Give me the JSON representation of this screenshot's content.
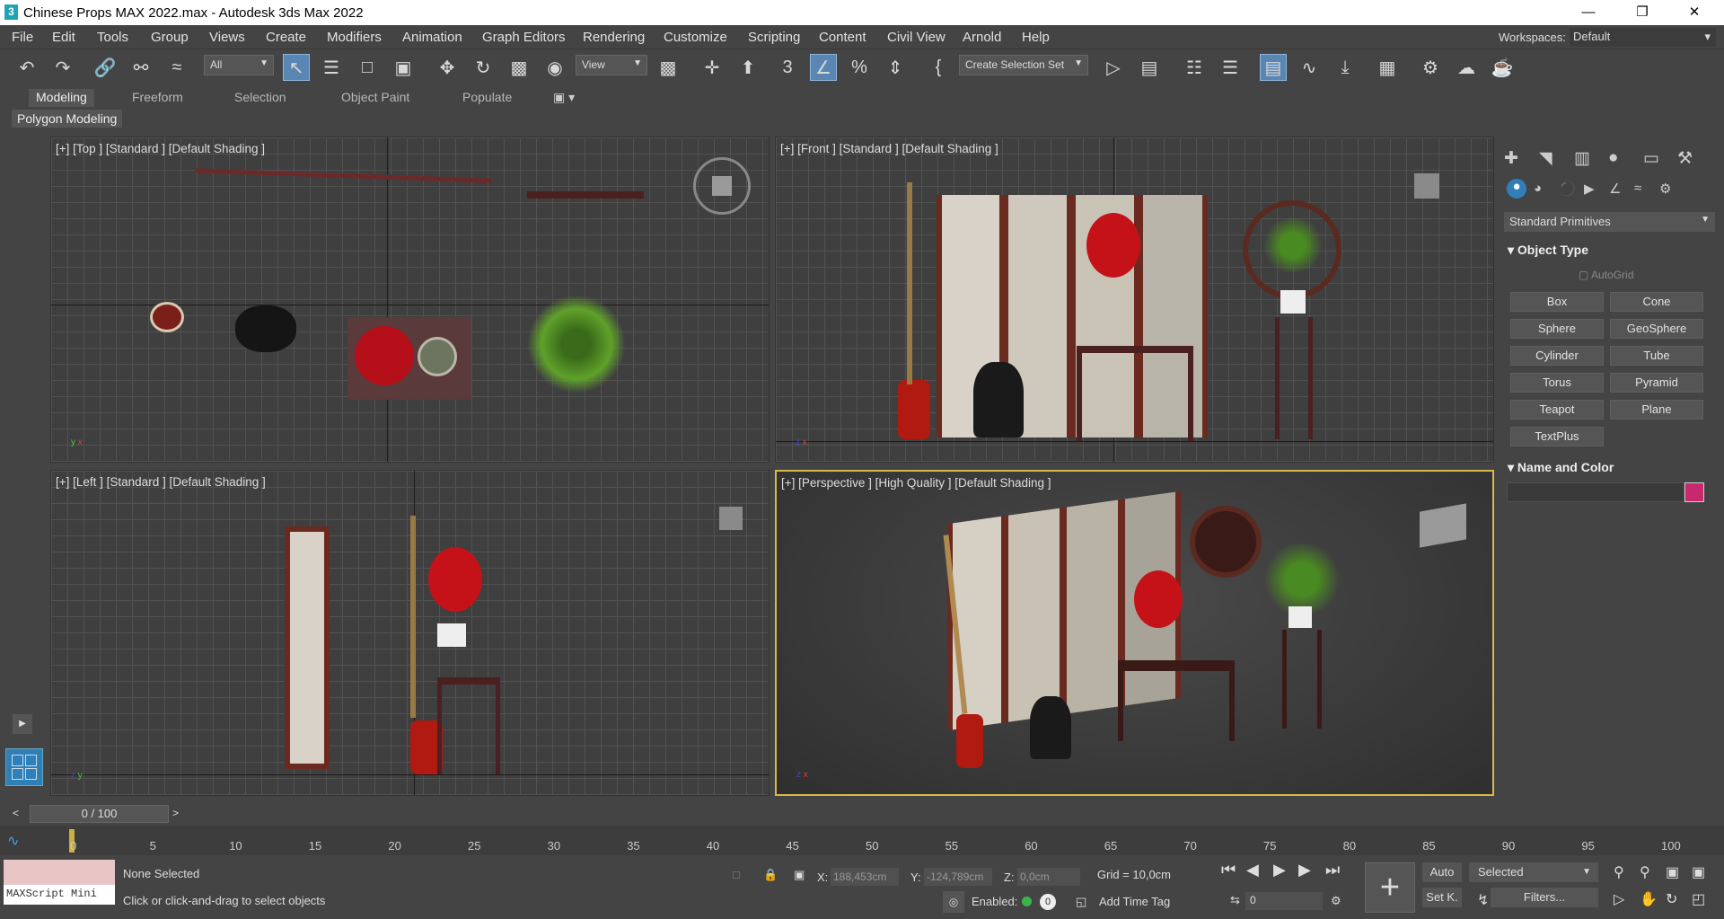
{
  "window": {
    "title": "Chinese Props MAX 2022.max - Autodesk 3ds Max 2022",
    "icon": "3"
  },
  "menu": [
    "File",
    "Edit",
    "Tools",
    "Group",
    "Views",
    "Create",
    "Modifiers",
    "Animation",
    "Graph Editors",
    "Rendering",
    "Customize",
    "Scripting",
    "Content",
    "Civil View",
    "Arnold",
    "Help"
  ],
  "workspace": {
    "label": "Workspaces:",
    "value": "Default"
  },
  "toolbar": {
    "filter": "All",
    "ref_coord": "View",
    "selection_set": "Create Selection Set"
  },
  "ribbon": {
    "tabs": [
      "Modeling",
      "Freeform",
      "Selection",
      "Object Paint",
      "Populate"
    ],
    "panel": "Polygon Modeling"
  },
  "viewports": {
    "top": "[+] [Top ] [Standard ] [Default Shading ]",
    "front": "[+] [Front ] [Standard ] [Default Shading ]",
    "left": "[+] [Left ] [Standard ] [Default Shading ]",
    "perspective": "[+] [Perspective ] [High Quality ] [Default Shading ]"
  },
  "command_panel": {
    "dropdown": "Standard Primitives",
    "object_type": "Object Type",
    "autogrid": "AutoGrid",
    "primitives": [
      "Box",
      "Cone",
      "Sphere",
      "GeoSphere",
      "Cylinder",
      "Tube",
      "Torus",
      "Pyramid",
      "Teapot",
      "Plane",
      "TextPlus"
    ],
    "name_and_color": "Name and Color",
    "color": "#c8296e"
  },
  "time": {
    "slider": "0 / 100",
    "ticks": [
      "0",
      "5",
      "10",
      "15",
      "20",
      "25",
      "30",
      "35",
      "40",
      "45",
      "50",
      "55",
      "60",
      "65",
      "70",
      "75",
      "80",
      "85",
      "90",
      "95",
      "100"
    ]
  },
  "status": {
    "selection": "None Selected",
    "prompt": "Click or click-and-drag to select objects",
    "maxscript": "MAXScript Mini",
    "x_label": "X:",
    "x": "188,453cm",
    "y_label": "Y:",
    "y": "-124,789cm",
    "z_label": "Z:",
    "z": "0,0cm",
    "grid": "Grid = 10,0cm",
    "enabled": "Enabled:",
    "add_time_tag": "Add Time Tag",
    "auto": "Auto",
    "set_key": "Set K.",
    "key_filter": "Selected",
    "filters": "Filters...",
    "frame": "0"
  }
}
